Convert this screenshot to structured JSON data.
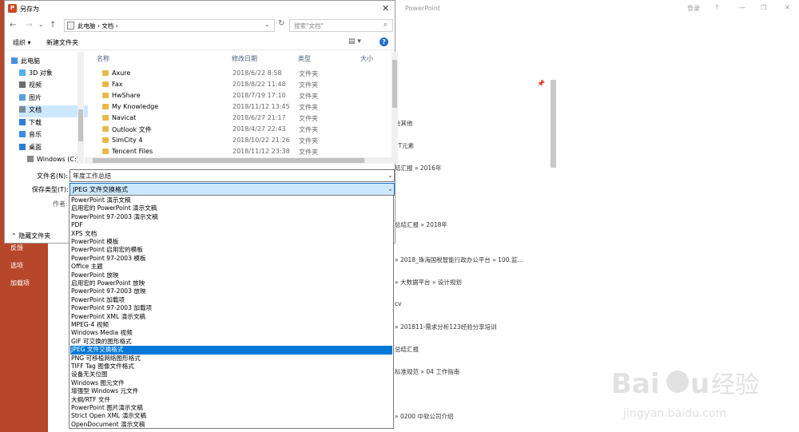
{
  "background": {
    "app_title": "PowerPoint",
    "login": "登录",
    "help": "?",
    "minimize": "—",
    "restore": "❐",
    "close": "✕",
    "left_menu": [
      "反馈",
      "选项",
      "加载项"
    ],
    "recent_paths": [
      "会其他",
      "PT元素",
      "结汇报 » 2016年",
      "总结汇报 » 2018年",
      "» 2018_珠海国税智能行政办公平台 » 100.监...",
      "» 大数据平台 » 设计规划",
      "cv",
      "» 201811-需求分析123经验分享培训",
      "总结汇报",
      "标准规范 » 04 工作指南",
      "» 0200 中软公司介绍"
    ],
    "watermark": "Baidu经验 jingyan.baidu.com"
  },
  "dialog": {
    "title": "另存为",
    "close": "✕",
    "nav_back": "←",
    "nav_forward": "→",
    "nav_recent": "⌄",
    "nav_up": "↑",
    "address": "此电脑  ›  文档  ›",
    "address_chevron": "⌄",
    "refresh": "↻",
    "search_placeholder": "搜索\"文档\"",
    "toolbar": {
      "organize": "组织 ▾",
      "new_folder": "新建文件夹",
      "view": "▤ ▾",
      "help": "?"
    },
    "nav_pane": [
      {
        "label": "此电脑",
        "icon": "pc-icon",
        "color": "#4a90d9"
      },
      {
        "label": "3D 对象",
        "icon": "cube-icon",
        "color": "#4fb3e8"
      },
      {
        "label": "视频",
        "icon": "video-icon",
        "color": "#6b6b6b"
      },
      {
        "label": "图片",
        "icon": "picture-icon",
        "color": "#5aa0d8"
      },
      {
        "label": "文档",
        "icon": "document-icon",
        "color": "#7a8a9a"
      },
      {
        "label": "下载",
        "icon": "download-icon",
        "color": "#2d7dd2"
      },
      {
        "label": "音乐",
        "icon": "music-icon",
        "color": "#3a8de0"
      },
      {
        "label": "桌面",
        "icon": "desktop-icon",
        "color": "#2d7dd2"
      },
      {
        "label": "Windows (C:)",
        "icon": "drive-icon",
        "color": "#888888"
      }
    ],
    "columns": {
      "name": "名称",
      "date": "修改日期",
      "type": "类型",
      "size": "大小"
    },
    "files": [
      {
        "name": "Axure",
        "date": "2018/6/22 8:58",
        "type": "文件夹"
      },
      {
        "name": "Fax",
        "date": "2018/8/22 11:48",
        "type": "文件夹"
      },
      {
        "name": "HwShare",
        "date": "2018/7/19 17:10",
        "type": "文件夹"
      },
      {
        "name": "My Knowledge",
        "date": "2018/11/12 13:45",
        "type": "文件夹"
      },
      {
        "name": "Navicat",
        "date": "2018/6/27 21:17",
        "type": "文件夹"
      },
      {
        "name": "Outlook 文件",
        "date": "2018/4/27 22:43",
        "type": "文件夹"
      },
      {
        "name": "SimCity 4",
        "date": "2018/10/22 21:26",
        "type": "文件夹"
      },
      {
        "name": "Tencent Files",
        "date": "2018/11/12 23:38",
        "type": "文件夹"
      }
    ],
    "filename_label": "文件名(N):",
    "filename_value": "年度工作总结",
    "filetype_label": "保存类型(T):",
    "filetype_value": "JPEG 文件交换格式",
    "author_label": "作者:",
    "hide_folders": "隐藏文件夹",
    "selected_option": "JPEG 文件交换格式",
    "options": [
      "PowerPoint 演示文稿",
      "启用宏的 PowerPoint 演示文稿",
      "PowerPoint 97-2003 演示文稿",
      "PDF",
      "XPS 文档",
      "PowerPoint 模板",
      "PowerPoint 启用宏的模板",
      "PowerPoint 97-2003 模板",
      "Office 主题",
      "PowerPoint 放映",
      "启用宏的 PowerPoint 放映",
      "PowerPoint 97-2003 放映",
      "PowerPoint 加载项",
      "PowerPoint 97-2003 加载项",
      "PowerPoint XML 演示文稿",
      "MPEG-4 视频",
      "Windows Media 视频",
      "GIF 可交换的图形格式",
      "JPEG 文件交换格式",
      "PNG 可移植网络图形格式",
      "TIFF Tag 图像文件格式",
      "设备无关位图",
      "Windows 图元文件",
      "增强型 Windows 元文件",
      "大纲/RTF 文件",
      "PowerPoint 图片演示文稿",
      "Strict Open XML 演示文稿",
      "OpenDocument 演示文稿"
    ]
  }
}
